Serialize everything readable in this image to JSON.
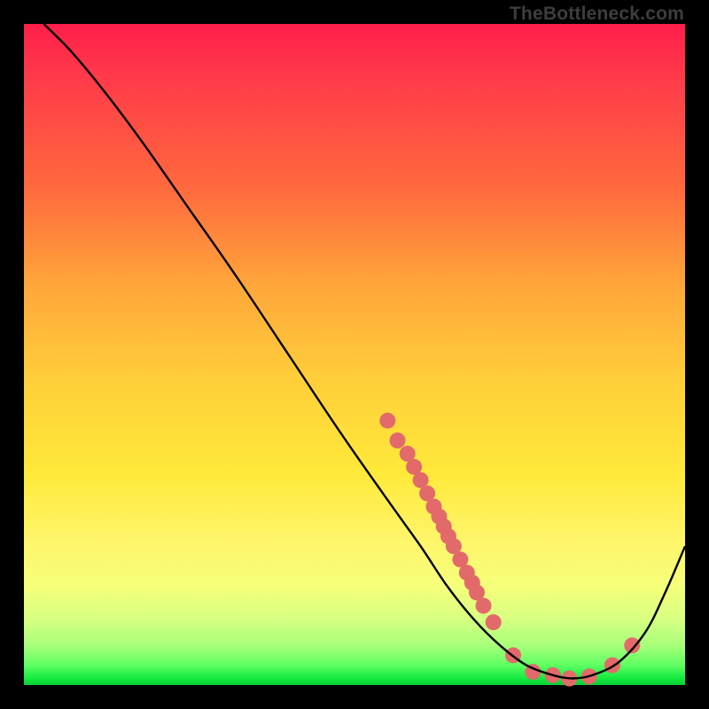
{
  "attribution": "TheBottleneck.com",
  "chart_data": {
    "type": "line",
    "title": "",
    "xlabel": "",
    "ylabel": "",
    "xlim": [
      0,
      100
    ],
    "ylim": [
      0,
      100
    ],
    "grid": false,
    "series": [
      {
        "name": "bottleneck-curve",
        "x": [
          3,
          7,
          12,
          18,
          25,
          32,
          40,
          48,
          55,
          60,
          64,
          68,
          72,
          76,
          80,
          83,
          86,
          90,
          94,
          97,
          100
        ],
        "y": [
          100,
          96,
          90,
          82,
          72,
          62,
          50,
          38,
          28,
          21,
          15,
          10,
          6,
          3,
          1.5,
          1,
          1.5,
          3.5,
          8,
          14,
          21
        ],
        "color": "#000000",
        "width": 2.4
      }
    ],
    "markers": [
      {
        "name": "highlight-dots",
        "color": "#e26a6a",
        "radius": 9,
        "points": [
          {
            "x": 55,
            "y": 40
          },
          {
            "x": 56.5,
            "y": 37
          },
          {
            "x": 58,
            "y": 35
          },
          {
            "x": 59,
            "y": 33
          },
          {
            "x": 60,
            "y": 31
          },
          {
            "x": 61,
            "y": 29
          },
          {
            "x": 62,
            "y": 27
          },
          {
            "x": 62.8,
            "y": 25.5
          },
          {
            "x": 63.5,
            "y": 24
          },
          {
            "x": 64.2,
            "y": 22.5
          },
          {
            "x": 65,
            "y": 21
          },
          {
            "x": 66,
            "y": 19
          },
          {
            "x": 67,
            "y": 17
          },
          {
            "x": 67.8,
            "y": 15.5
          },
          {
            "x": 68.5,
            "y": 14
          },
          {
            "x": 69.5,
            "y": 12
          },
          {
            "x": 71,
            "y": 9.5
          },
          {
            "x": 74,
            "y": 4.5
          },
          {
            "x": 77,
            "y": 2
          },
          {
            "x": 80,
            "y": 1.5
          },
          {
            "x": 82.5,
            "y": 1
          },
          {
            "x": 85.5,
            "y": 1.3
          },
          {
            "x": 89,
            "y": 3
          },
          {
            "x": 92,
            "y": 6
          }
        ]
      }
    ]
  }
}
